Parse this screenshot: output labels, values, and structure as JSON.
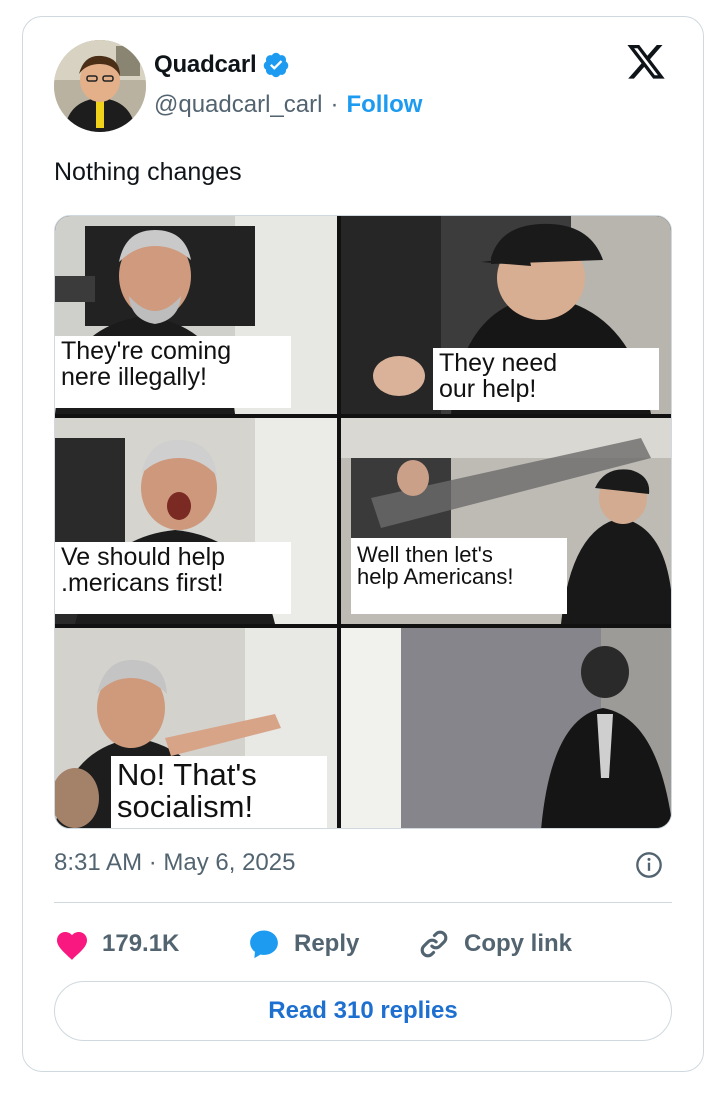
{
  "author": {
    "display_name": "Quadcarl",
    "handle": "@quadcarl_carl",
    "separator": "·",
    "follow_label": "Follow"
  },
  "tweet": {
    "text": "Nothing changes",
    "timestamp": "8:31 AM · May 6, 2025"
  },
  "meme": {
    "captions": [
      {
        "line1": "They're coming",
        "line2": "nere illegally!"
      },
      {
        "line1": "They need",
        "line2": "our help!"
      },
      {
        "line1": "Ve should help",
        "line2": ".mericans first!"
      },
      {
        "line1": "Well then let's",
        "line2": "help Americans!"
      },
      {
        "line1": "No! That's",
        "line2": "socialism!"
      }
    ]
  },
  "actions": {
    "likes": "179.1K",
    "reply_label": "Reply",
    "copy_label": "Copy link"
  },
  "read_replies_label": "Read 310 replies",
  "colors": {
    "accent": "#1d9bf0",
    "like": "#f91880",
    "text": "#0f1419",
    "muted": "#536471",
    "border": "#cfd9de"
  },
  "icons": [
    "verified-badge-icon",
    "x-logo-icon",
    "info-icon",
    "heart-icon",
    "reply-bubble-icon",
    "link-icon"
  ]
}
